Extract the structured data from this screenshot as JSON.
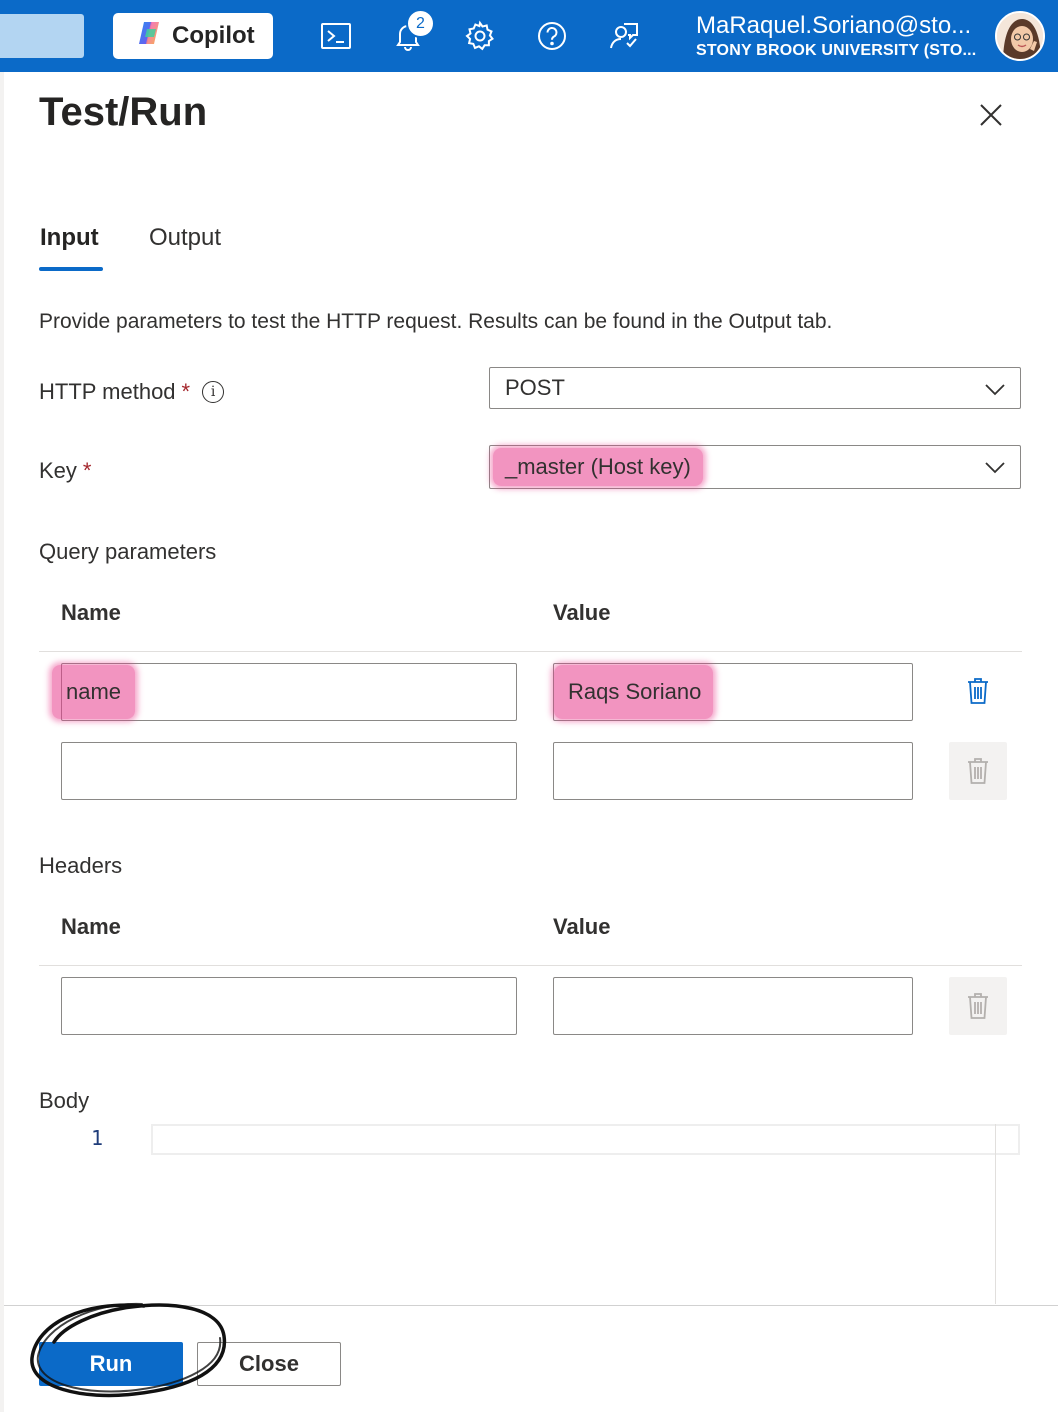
{
  "topbar": {
    "copilot_label": "Copilot",
    "notification_count": "2",
    "account_email": "MaRaquel.Soriano@sto...",
    "account_org": "STONY BROOK UNIVERSITY (STO...",
    "brand_color": "#0b6ac8",
    "icons": [
      "cloud-shell-icon",
      "notifications-icon",
      "settings-icon",
      "help-icon",
      "feedback-icon"
    ]
  },
  "panel": {
    "title": "Test/Run",
    "tabs": [
      {
        "label": "Input",
        "selected": true
      },
      {
        "label": "Output",
        "selected": false
      }
    ],
    "description": "Provide parameters to test the HTTP request. Results can be found in the Output tab.",
    "http_method": {
      "label": "HTTP method",
      "required_mark": "*",
      "value": "POST"
    },
    "key": {
      "label": "Key",
      "required_mark": "*",
      "value": "_master (Host key)"
    },
    "query_parameters": {
      "label": "Query parameters",
      "columns": [
        "Name",
        "Value"
      ],
      "rows": [
        {
          "name": "name",
          "value": "Raqs Soriano"
        },
        {
          "name": "",
          "value": ""
        }
      ]
    },
    "headers": {
      "label": "Headers",
      "columns": [
        "Name",
        "Value"
      ],
      "rows": [
        {
          "name": "",
          "value": ""
        }
      ]
    },
    "body": {
      "label": "Body",
      "line_numbers": [
        "1"
      ],
      "content": ""
    },
    "buttons": {
      "run": "Run",
      "close": "Close"
    },
    "highlight_color": "#e83c8c"
  }
}
